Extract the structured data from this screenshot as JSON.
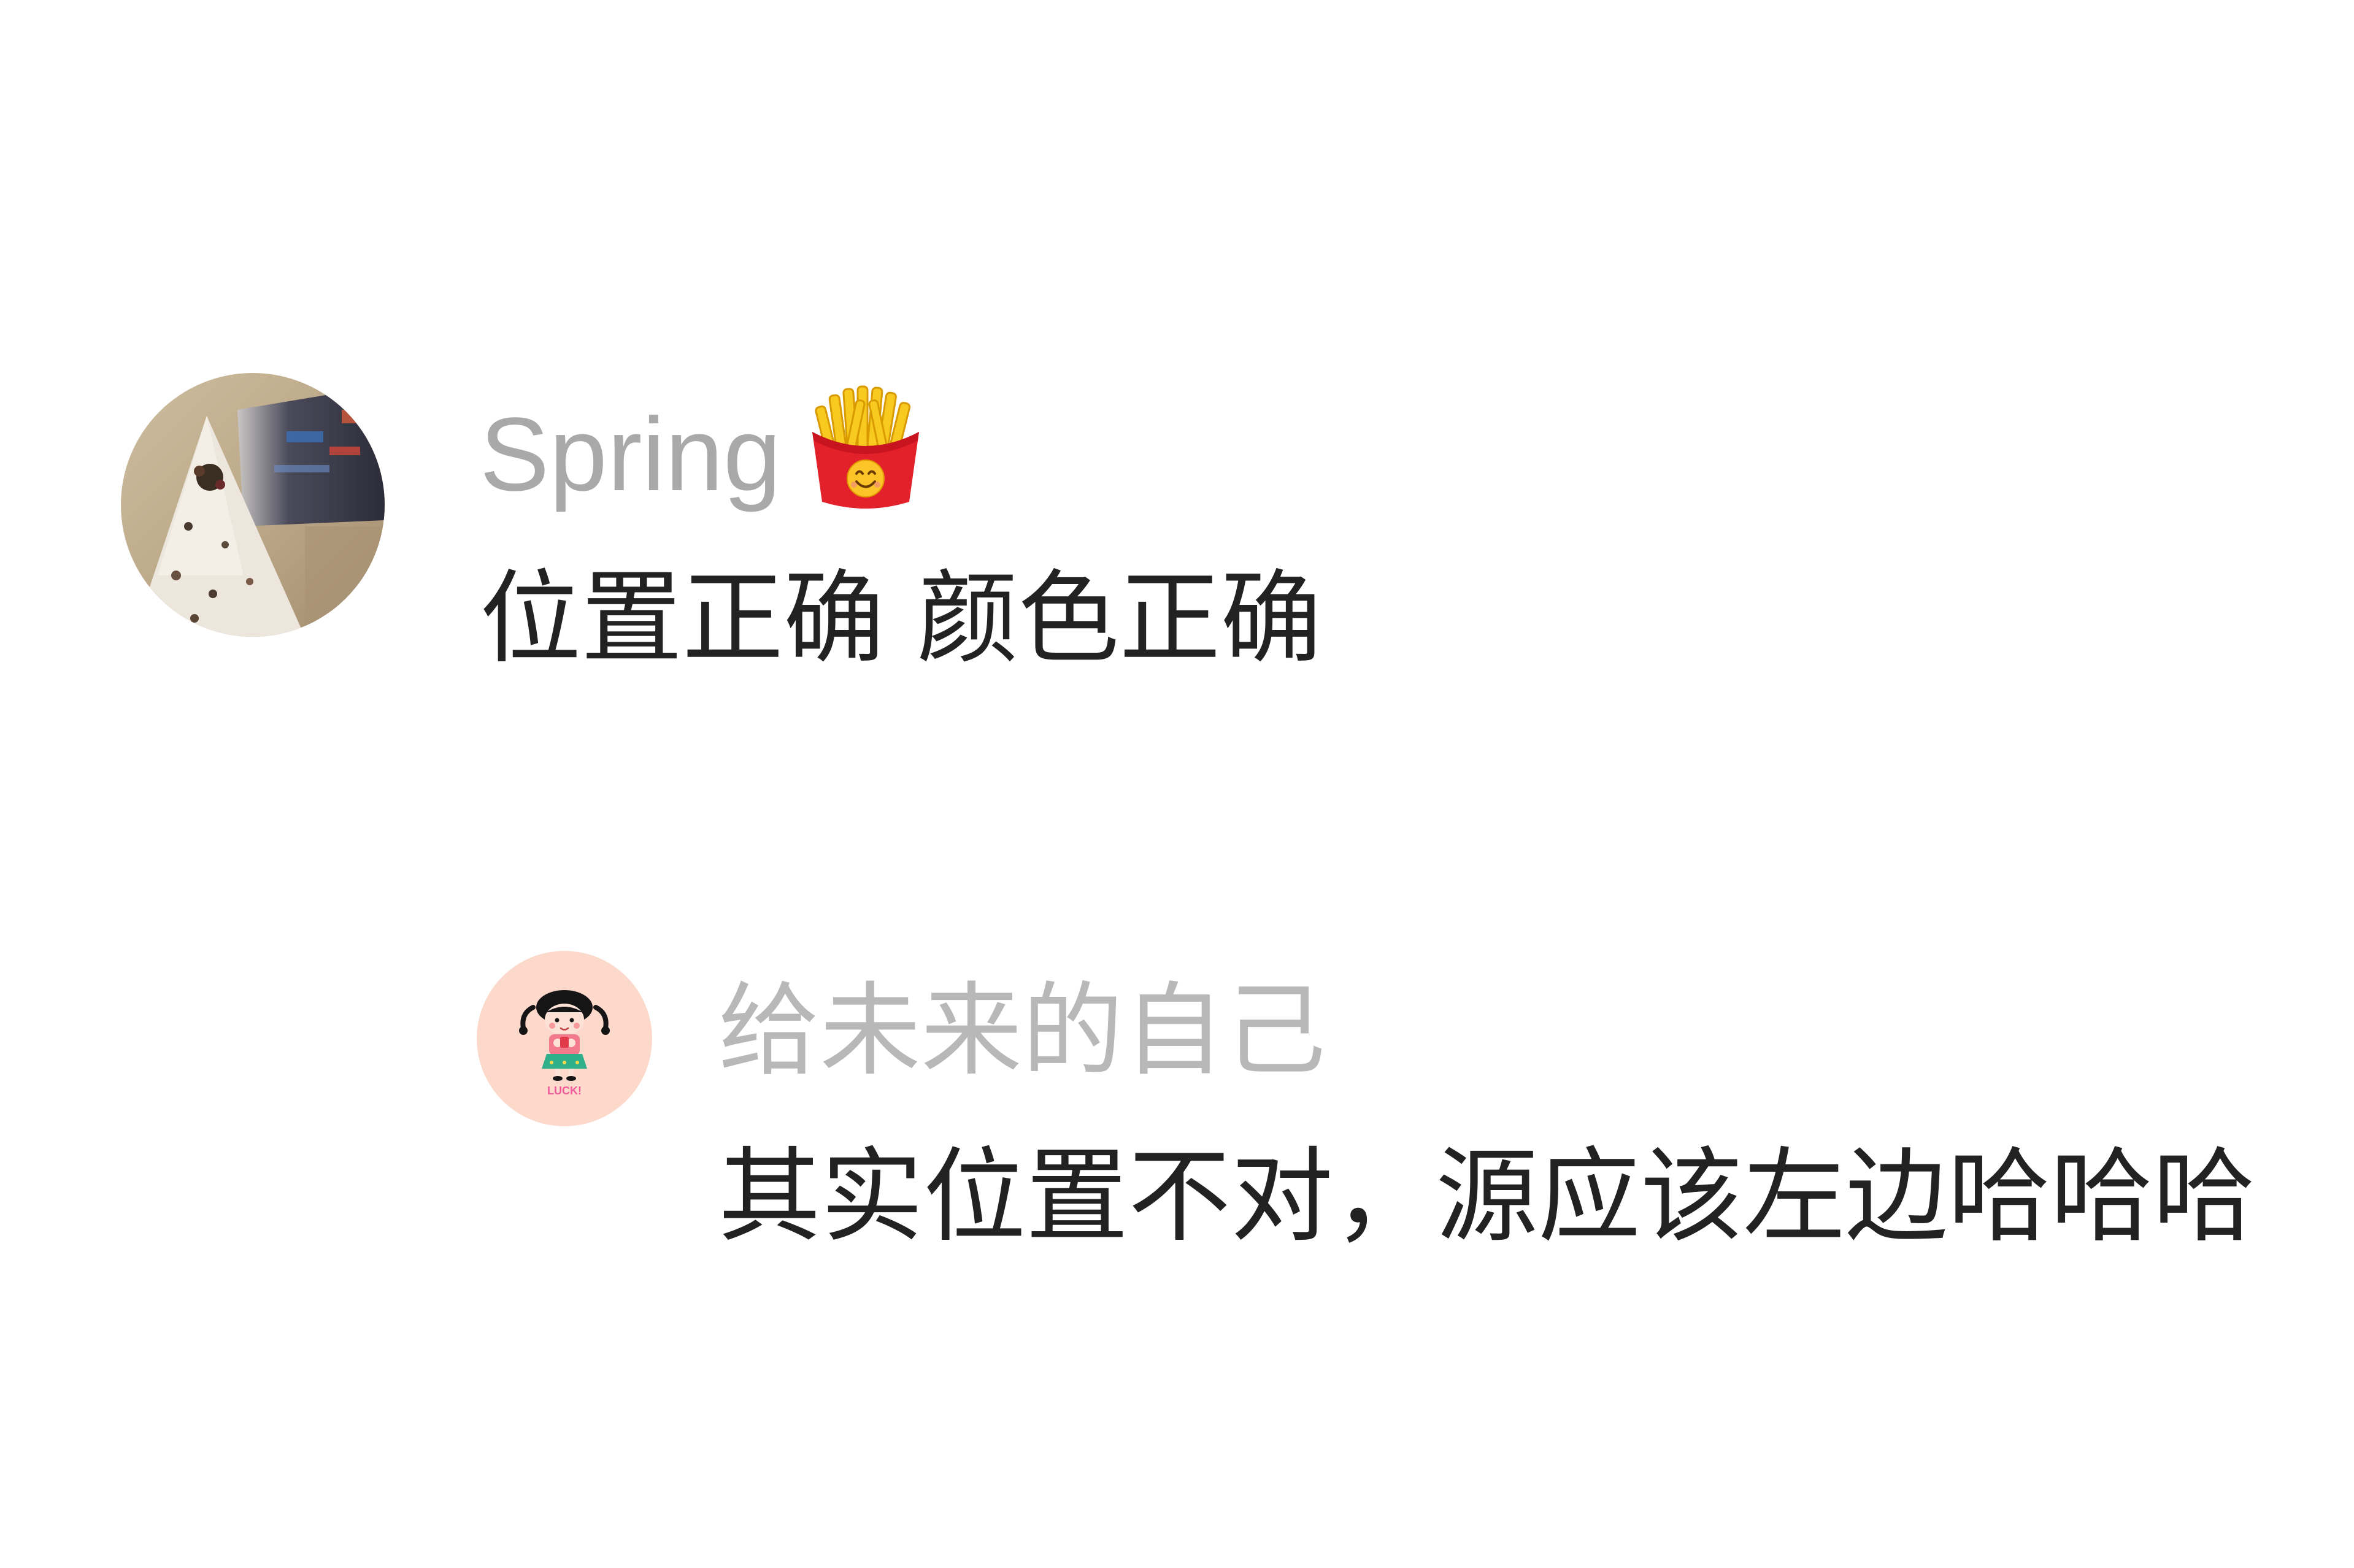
{
  "colors": {
    "background": "#ffffff",
    "username": "#a9a9a9",
    "reply_username": "#b8b8b8",
    "comment_text": "#222222",
    "reply_avatar_bg": "#fdd9cb"
  },
  "comment": {
    "avatar": "christmas-tree-photo-avatar",
    "username": "Spring",
    "username_emoji": "french-fries-icon",
    "text": "位置正确 颜色正确"
  },
  "reply": {
    "avatar": "cartoon-girl-avatar",
    "avatar_badge_text": "LUCK!",
    "username": "给未来的自己",
    "text": "其实位置不对，源应该左边哈哈哈"
  }
}
